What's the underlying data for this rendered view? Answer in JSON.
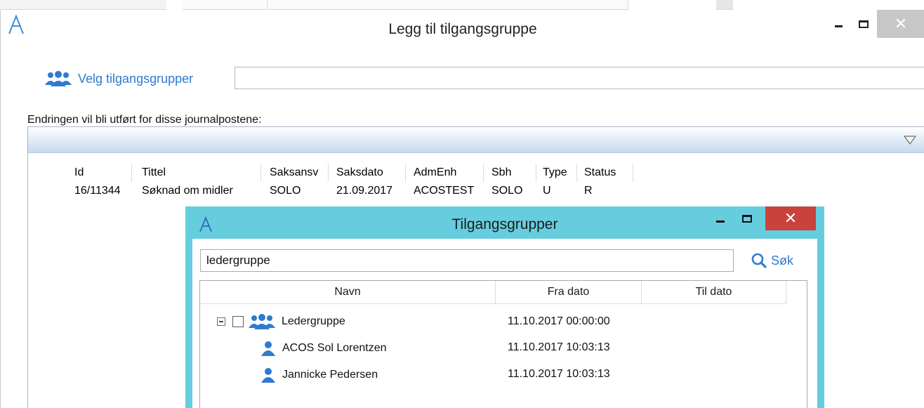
{
  "main_window": {
    "title": "Legg til tilgangsgruppe",
    "close_glyph": "✕",
    "select_groups_label": "Velg tilgangsgrupper",
    "select_groups_value": "",
    "info_text": "Endringen vil bli utført for disse journalpostene:"
  },
  "records_grid": {
    "columns": [
      "Id",
      "Tittel",
      "Saksansv",
      "Saksdato",
      "AdmEnh",
      "Sbh",
      "Type",
      "Status"
    ],
    "rows": [
      {
        "id": "16/11344",
        "tittel": "Søknad om midler",
        "saksansv": "SOLO",
        "saksdato": "21.09.2017",
        "admenh": "ACOSTEST",
        "sbh": "SOLO",
        "type": "U",
        "status": "R"
      }
    ]
  },
  "popup": {
    "title": "Tilgangsgrupper",
    "close_glyph": "✕",
    "search_value": "ledergruppe",
    "search_button_label": "Søk",
    "columns": [
      "Navn",
      "Fra dato",
      "Til dato"
    ],
    "rows": [
      {
        "name": "Ledergruppe",
        "fra_dato": "11.10.2017 00:00:00",
        "til_dato": "",
        "icon": "group-icon",
        "expandable": true,
        "checked": false
      },
      {
        "name": "ACOS Sol Lorentzen",
        "fra_dato": "11.10.2017 10:03:13",
        "til_dato": "",
        "icon": "user-icon"
      },
      {
        "name": "Jannicke Pedersen",
        "fra_dato": "11.10.2017 10:03:13",
        "til_dato": "",
        "icon": "user-icon"
      }
    ]
  },
  "colors": {
    "accent_blue": "#2e7bcf",
    "popup_frame": "#66cddf",
    "close_red": "#c9423c",
    "grid_header_band": "#dfeaf7"
  }
}
